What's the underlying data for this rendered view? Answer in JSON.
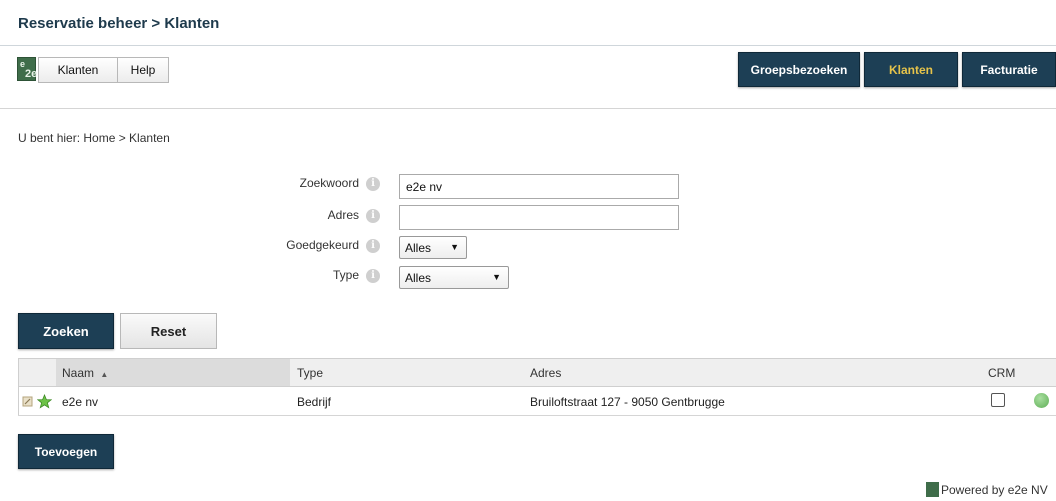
{
  "header": {
    "title": "Reservatie beheer > Klanten"
  },
  "toolbar": {
    "logo_text_top": "e",
    "logo_text_bottom": "2e",
    "menu": [
      "Klanten",
      "Help"
    ]
  },
  "nav": {
    "items": [
      "Groepsbezoeken",
      "Klanten",
      "Facturatie"
    ],
    "active": "Klanten",
    "active_color": "#e6c34a",
    "button_color": "#1d3f55"
  },
  "breadcrumb": "U bent hier: Home > Klanten",
  "form": {
    "zoekwoord": {
      "label": "Zoekwoord",
      "value": "e2e nv"
    },
    "adres": {
      "label": "Adres",
      "value": ""
    },
    "goedgekeurd": {
      "label": "Goedgekeurd",
      "selected": "Alles"
    },
    "type": {
      "label": "Type",
      "selected": "Alles"
    }
  },
  "buttons": {
    "search": "Zoeken",
    "reset": "Reset",
    "add": "Toevoegen"
  },
  "table": {
    "columns": [
      "Naam",
      "Type",
      "Adres",
      "CRM"
    ],
    "sort_indicator": "▲",
    "rows": [
      {
        "naam": "e2e nv",
        "type": "Bedrijf",
        "adres": "Bruiloftstraat 127 - 9050 Gentbrugge",
        "crm": false
      }
    ]
  },
  "footer": {
    "text": "Powered by e2e NV"
  }
}
